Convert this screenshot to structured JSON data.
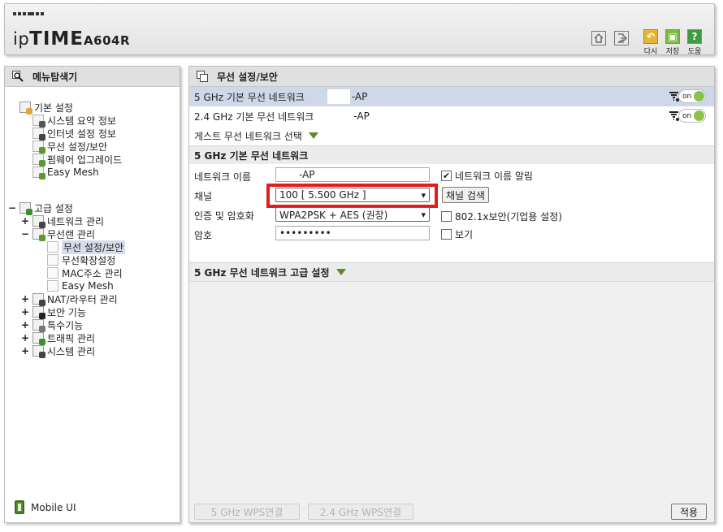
{
  "header": {
    "brand_prefix": "ip",
    "brand_bold": "TIME",
    "model": "A604R",
    "tools": {
      "redo": "다시",
      "save": "저장",
      "help": "도움"
    }
  },
  "sidebar": {
    "title": "메뉴탐색기",
    "basic": {
      "label": "기본 설정",
      "items": [
        "시스템 요약 정보",
        "인터넷 설정 정보",
        "무선 설정/보안",
        "펌웨어 업그레이드",
        "Easy Mesh"
      ]
    },
    "advanced": {
      "label": "고급 설정",
      "network": "네트워크 관리",
      "wireless": "무선랜 관리",
      "wireless_items": [
        "무선 설정/보안",
        "무선확장설정",
        "MAC주소 관리",
        "Easy Mesh"
      ],
      "others": [
        "NAT/라우터 관리",
        "보안 기능",
        "특수기능",
        "트래픽 관리",
        "시스템 관리"
      ]
    },
    "mobile_ui": "Mobile UI"
  },
  "main": {
    "title": "무선 설정/보안",
    "networks": [
      {
        "label": "5 GHz 기본 무선 네트워크",
        "ssid": "-AP",
        "toggle": "on"
      },
      {
        "label": "2.4 GHz 기본 무선 네트워크",
        "ssid": "-AP",
        "toggle": "on"
      }
    ],
    "guest": "게스트 무선 네트워크 선택",
    "section_5g": "5 GHz 기본 무선 네트워크",
    "form": {
      "name_label": "네트워크 이름",
      "name_value": "-AP",
      "broadcast_label": "네트워크 이름 알림",
      "channel_label": "채널",
      "channel_value": "100 [ 5.500 GHz ]",
      "scan_button": "채널 검색",
      "auth_label": "인증 및 암호화",
      "auth_value": "WPA2PSK + AES (권장)",
      "enterprise_label": "802.1x보안(기업용 설정)",
      "password_label": "암호",
      "password_value": "•••••••••",
      "show_label": "보기"
    },
    "advanced_5g": "5 GHz 무선 네트워크 고급 설정",
    "footer": {
      "wps5": "5 GHz WPS연결",
      "wps24": "2.4 GHz WPS연결",
      "apply": "적용"
    }
  },
  "colors": {
    "accent_green": "#8bc34a",
    "highlight_red": "#e01e1e",
    "selected_row": "#cfd8e8"
  }
}
